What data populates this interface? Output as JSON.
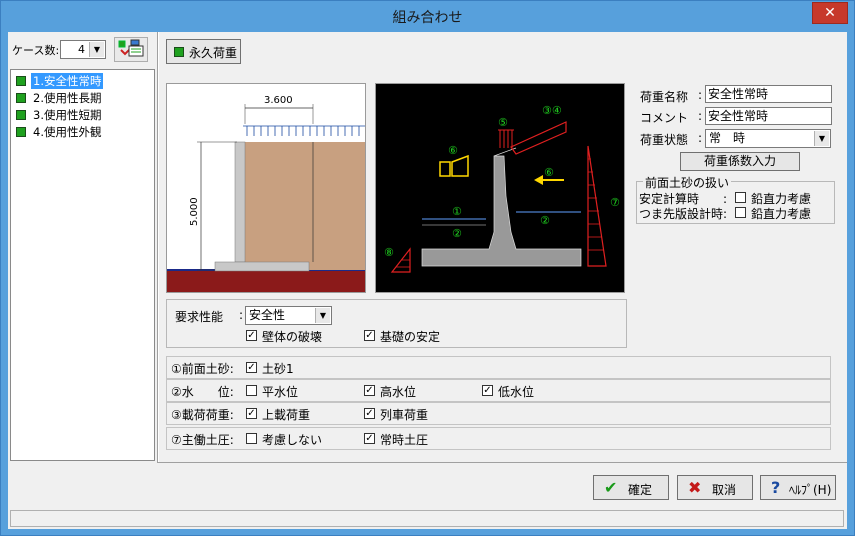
{
  "window": {
    "title": "組み合わせ",
    "close_glyph": "✕"
  },
  "cases": {
    "label": "ケース数:",
    "count": "4",
    "items": [
      {
        "label": "1.安全性常時"
      },
      {
        "label": "2.使用性長期"
      },
      {
        "label": "3.使用性短期"
      },
      {
        "label": "4.使用性外観"
      }
    ]
  },
  "toolbar": {
    "permanent_load": "永久荷重"
  },
  "figure1": {
    "width_dim": "3.600",
    "height_dim": "5.000"
  },
  "figure2": {
    "labels": [
      "③④",
      "⑤",
      "⑥",
      "⑥",
      "⑦",
      "①",
      "②",
      "②",
      "⑧",
      "①"
    ]
  },
  "load": {
    "name_label": "荷重名称",
    "name_value": "安全性常時",
    "comment_label": "コメント",
    "comment_value": "安全性常時",
    "state_label": "荷重状態",
    "state_value": "常　時",
    "coef_button": "荷重係数入力"
  },
  "front_soil": {
    "title": "前面土砂の扱い",
    "safety_label": "安定計算時　　:",
    "toe_label": "つま先版設計時:",
    "vertical_label": "鉛直力考慮"
  },
  "req": {
    "label": "要求性能",
    "value": "安全性",
    "opt1": "壁体の破壊",
    "opt2": "基礎の安定"
  },
  "rows": [
    {
      "label": "①前面土砂:",
      "items": [
        {
          "text": "土砂1",
          "checked": true
        }
      ]
    },
    {
      "label": "②水　　位:",
      "items": [
        {
          "text": "平水位",
          "checked": false
        },
        {
          "text": "高水位",
          "checked": true
        },
        {
          "text": "低水位",
          "checked": true
        }
      ]
    },
    {
      "label": "③載荷荷重:",
      "items": [
        {
          "text": "上載荷重",
          "checked": true
        },
        {
          "text": "列車荷重",
          "checked": true
        }
      ]
    },
    {
      "label": "⑦主働土圧:",
      "items": [
        {
          "text": "考慮しない",
          "checked": false
        },
        {
          "text": "常時土圧",
          "checked": true
        }
      ]
    }
  ],
  "actions": {
    "ok": "確定",
    "cancel": "取消",
    "help": "ﾍﾙﾌﾟ(H)"
  },
  "colors": {
    "accent": "#3399ff",
    "green": "#1fa11f",
    "soil": "#c8a080",
    "base": "#8b1a1a"
  }
}
